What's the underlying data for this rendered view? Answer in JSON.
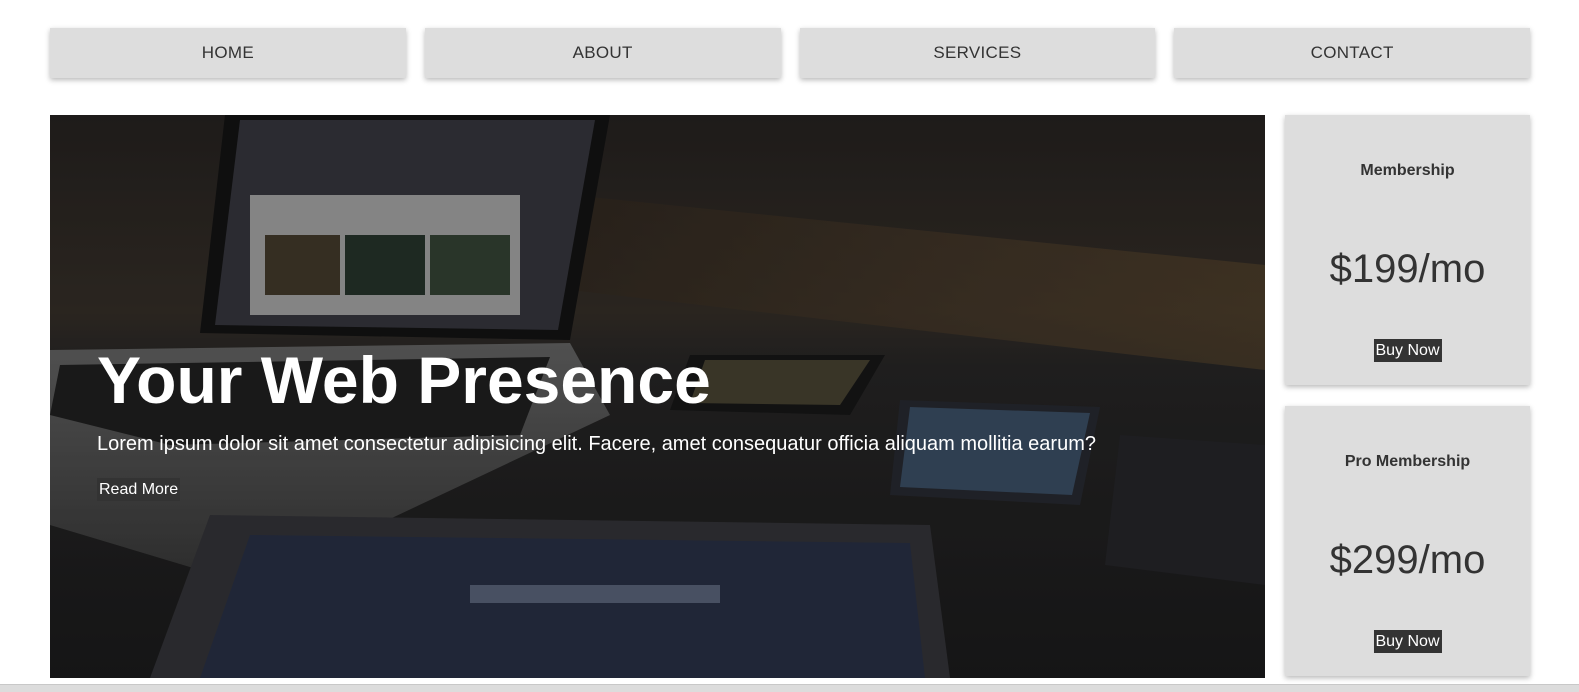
{
  "nav": {
    "items": [
      {
        "label": "HOME"
      },
      {
        "label": "ABOUT"
      },
      {
        "label": "SERVICES"
      },
      {
        "label": "CONTACT"
      }
    ]
  },
  "hero": {
    "title": "Your Web Presence",
    "text": "Lorem ipsum dolor sit amet consectetur adipisicing elit. Facere, amet consequatur officia aliquam mollitia earum?",
    "button_label": "Read More",
    "image_icon": "laptop-and-devices-photo"
  },
  "pricing": [
    {
      "title": "Membership",
      "price": "$199/mo",
      "button_label": "Buy Now"
    },
    {
      "title": "Pro Membership",
      "price": "$299/mo",
      "button_label": "Buy Now"
    }
  ],
  "colors": {
    "nav_bg": "#dddddd",
    "button_bg": "#333333",
    "button_text": "#ffffff",
    "text": "#333333"
  }
}
